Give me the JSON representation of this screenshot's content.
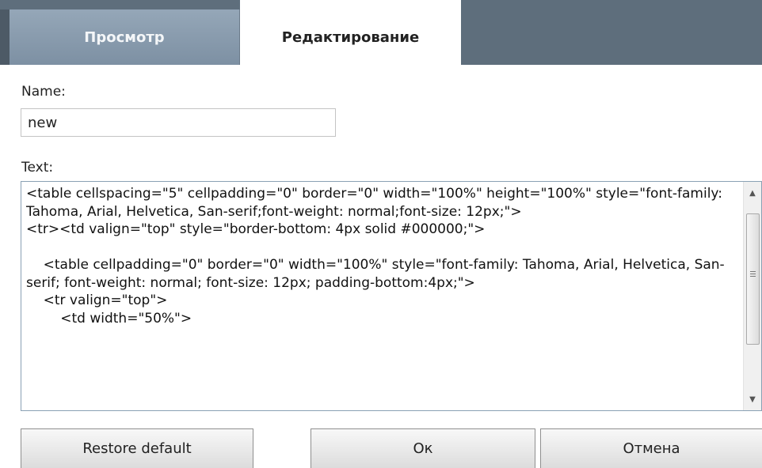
{
  "tabs": {
    "view_label": "Просмотр",
    "edit_label": "Редактирование"
  },
  "form": {
    "name_label": "Name:",
    "name_value": "new",
    "text_label": "Text:",
    "text_value": "<table cellspacing=\"5\" cellpadding=\"0\" border=\"0\" width=\"100%\" height=\"100%\" style=\"font-family: Tahoma, Arial, Helvetica, San-serif;font-weight: normal;font-size: 12px;\">\n<tr><td valign=\"top\" style=\"border-bottom: 4px solid #000000;\">\n\n    <table cellpadding=\"0\" border=\"0\" width=\"100%\" style=\"font-family: Tahoma, Arial, Helvetica, San-serif; font-weight: normal; font-size: 12px; padding-bottom:4px;\">\n    <tr valign=\"top\">\n        <td width=\"50%\">"
  },
  "buttons": {
    "restore_label": "Restore default",
    "ok_label": "Ок",
    "cancel_label": "Отмена"
  },
  "icons": {
    "scroll_up": "arrow-up-icon",
    "scroll_down": "arrow-down-icon",
    "scroll_grip": "grip-icon"
  }
}
